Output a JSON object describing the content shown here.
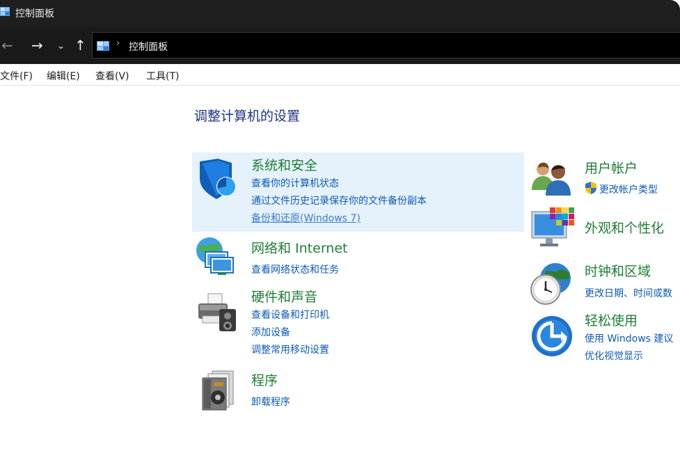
{
  "window": {
    "title": "控制面板"
  },
  "address": {
    "crumb": "控制面板",
    "separator": "›"
  },
  "nav": {
    "back": "←",
    "forward": "→",
    "dropdown": "⌄",
    "up": "↑"
  },
  "menu": [
    "文件(F)",
    "编辑(E)",
    "查看(V)",
    "工具(T)"
  ],
  "main": {
    "heading": "调整计算机的设置"
  },
  "categories_left": [
    {
      "title": "系统和安全",
      "links": [
        "查看你的计算机状态",
        "通过文件历史记录保存你的文件备份副本",
        "备份和还原(Windows 7)"
      ]
    },
    {
      "title": "网络和 Internet",
      "links": [
        "查看网络状态和任务"
      ]
    },
    {
      "title": "硬件和声音",
      "links": [
        "查看设备和打印机",
        "添加设备",
        "调整常用移动设置"
      ]
    },
    {
      "title": "程序",
      "links": [
        "卸载程序"
      ]
    }
  ],
  "categories_right": [
    {
      "title": "用户帐户",
      "links": [
        "更改帐户类型"
      ]
    },
    {
      "title": "外观和个性化",
      "links": []
    },
    {
      "title": "时钟和区域",
      "links": [
        "更改日期、时间或数"
      ]
    },
    {
      "title": "轻松使用",
      "links": [
        "使用 Windows 建议",
        "优化视觉显示"
      ]
    }
  ],
  "colors": {
    "category_title": "#1e7e34",
    "link": "#0c5ab8",
    "heading": "#1e3287",
    "highlight": "#e5f1fb"
  }
}
